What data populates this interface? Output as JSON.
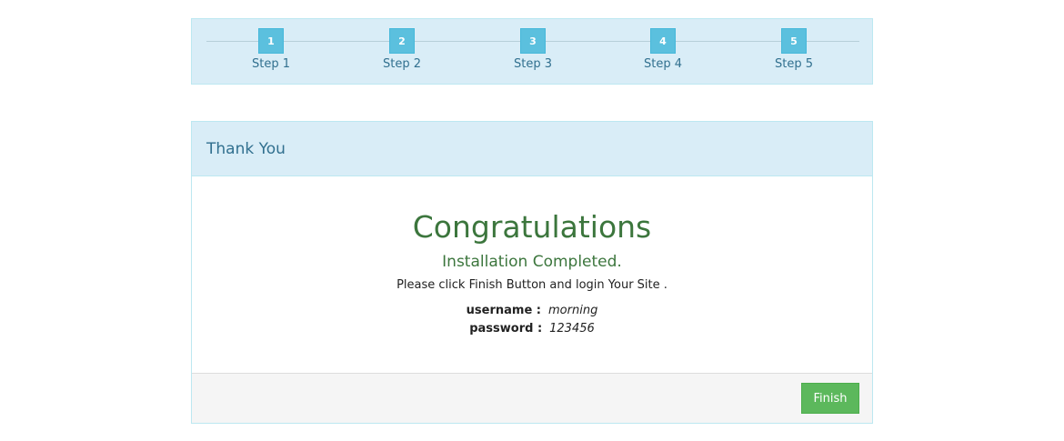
{
  "steps": [
    {
      "number": "1",
      "label": "Step 1"
    },
    {
      "number": "2",
      "label": "Step 2"
    },
    {
      "number": "3",
      "label": "Step 3"
    },
    {
      "number": "4",
      "label": "Step 4"
    },
    {
      "number": "5",
      "label": "Step 5"
    }
  ],
  "panel": {
    "heading": "Thank You",
    "congrats": "Congratulations",
    "completed": "Installation Completed.",
    "instruction": "Please click Finish Button and login Your Site .",
    "credentials": {
      "username_label": "username :",
      "username_value": "morning",
      "password_label": "password :",
      "password_value": "123456"
    },
    "finish_label": "Finish"
  },
  "colors": {
    "info_bg": "#d9edf7",
    "info_border": "#bce8f1",
    "info_text": "#31708f",
    "success_text": "#3c763d",
    "step_badge": "#5bc0de",
    "finish_button": "#5cb85c",
    "footer_bg": "#f5f5f5"
  }
}
